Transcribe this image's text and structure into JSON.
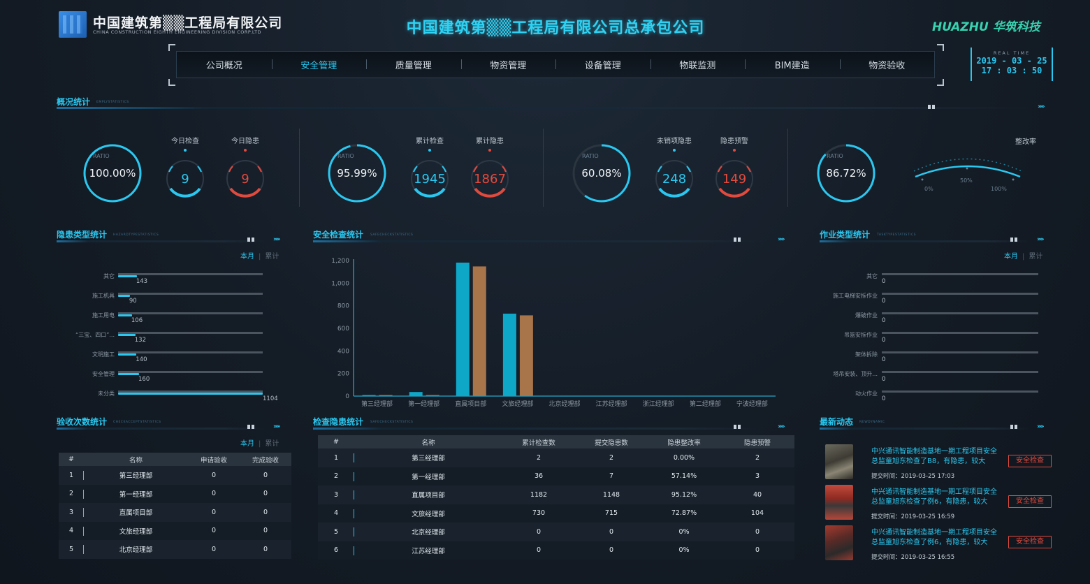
{
  "header": {
    "company_cn": "中国建筑第▒▒工程局有限公司",
    "company_en": "CHINA CONSTRUCTION EIGHTH ENGINEERING DIVISION CORP.LTD",
    "title": "中国建筑第▒▒工程局有限公司总承包公司",
    "brand": "HUAZHU 华筑科技"
  },
  "nav": {
    "items": [
      "公司概况",
      "安全管理",
      "质量管理",
      "物资管理",
      "设备管理",
      "物联监测",
      "BIM建造",
      "物资验收"
    ],
    "active_index": 1
  },
  "clock": {
    "label": "REAL TIME",
    "date": "2019 - 03 - 25",
    "time": "17 : 03 : 50"
  },
  "sections": {
    "overview": {
      "title": "概况统计",
      "sub": "EMPLYSTATISTICS"
    },
    "hazard_type": {
      "title": "隐患类型统计",
      "sub": "HAZARDTYPESTATISTICS"
    },
    "safety_check": {
      "title": "安全检查统计",
      "sub": "SAFECHECKSTATISTICS"
    },
    "work_type": {
      "title": "作业类型统计",
      "sub": "TASKTYPESTATISTICS"
    },
    "acceptance": {
      "title": "验收次数统计",
      "sub": "CHECKACCEPTSTATISTICS"
    },
    "check_hazard": {
      "title": "检查隐患统计",
      "sub": "SAFECHECKSTATISTICS"
    },
    "news": {
      "title": "最新动态",
      "sub": "NEWDYNAMIC"
    }
  },
  "overview": {
    "ratio_label": "RATIO",
    "groups": [
      {
        "ratio": "100.00%",
        "ratio_value": 1.0,
        "a_label": "今日检查",
        "a_value": "9",
        "b_label": "今日隐患",
        "b_value": "9"
      },
      {
        "ratio": "95.99%",
        "ratio_value": 0.9599,
        "a_label": "累计检查",
        "a_value": "1945",
        "b_label": "累计隐患",
        "b_value": "1867"
      },
      {
        "ratio": "60.08%",
        "ratio_value": 0.6008,
        "a_label": "未销项隐患",
        "a_value": "248",
        "b_label": "隐患预警",
        "b_value": "149"
      },
      {
        "ratio": "86.72%",
        "ratio_value": 0.8672
      }
    ],
    "rate_meter": {
      "title": "整改率",
      "tick_0": "0%",
      "tick_50": "50%",
      "tick_100": "100%"
    },
    "colors": {
      "accent": "#2ac8f0",
      "alert": "#e24a3e"
    }
  },
  "toggle": {
    "month": "本月",
    "total": "累计"
  },
  "hazard_type": {
    "max": 1104,
    "items": [
      {
        "label": "其它",
        "value": "143",
        "v": 143
      },
      {
        "label": "施工机具",
        "value": "90",
        "v": 90
      },
      {
        "label": "施工用电",
        "value": "106",
        "v": 106
      },
      {
        "label": "“三宝、四口”...",
        "value": "132",
        "v": 132
      },
      {
        "label": "文明施工",
        "value": "140",
        "v": 140
      },
      {
        "label": "安全管理",
        "value": "160",
        "v": 160
      },
      {
        "label": "未分类",
        "value": "1104",
        "v": 1104
      }
    ]
  },
  "work_type": {
    "items": [
      {
        "label": "其它",
        "value": "0"
      },
      {
        "label": "施工电梯安拆作业",
        "value": "0"
      },
      {
        "label": "爆破作业",
        "value": "0"
      },
      {
        "label": "吊篮安拆作业",
        "value": "0"
      },
      {
        "label": "架体拆除",
        "value": "0"
      },
      {
        "label": "塔吊安装、顶升...",
        "value": "0"
      },
      {
        "label": "动火作业",
        "value": "0"
      }
    ]
  },
  "chart_data": {
    "type": "bar",
    "categories": [
      "第三经理部",
      "第一经理部",
      "直属项目部",
      "文旅经理部",
      "北京经理部",
      "江苏经理部",
      "浙江经理部",
      "第二经理部",
      "宁波经理部"
    ],
    "series": [
      {
        "values": [
          2,
          36,
          1182,
          730,
          0,
          0,
          0,
          0,
          0
        ],
        "color": "#0fa7c8"
      },
      {
        "values": [
          2,
          7,
          1148,
          715,
          0,
          0,
          0,
          0,
          0
        ],
        "color": "#a8744a"
      }
    ],
    "yticks": [
      "0",
      "200",
      "400",
      "600",
      "800",
      "1,000",
      "1,200"
    ],
    "ylim": [
      0,
      1200
    ]
  },
  "acceptance": {
    "headers": [
      "#",
      "名称",
      "申请验收",
      "完成验收"
    ],
    "rows": [
      [
        "1",
        "第三经理部",
        "0",
        "0"
      ],
      [
        "2",
        "第一经理部",
        "0",
        "0"
      ],
      [
        "3",
        "直属项目部",
        "0",
        "0"
      ],
      [
        "4",
        "文旅经理部",
        "0",
        "0"
      ],
      [
        "5",
        "北京经理部",
        "0",
        "0"
      ]
    ]
  },
  "check_hazard": {
    "headers": [
      "#",
      "名称",
      "累计检查数",
      "提交隐患数",
      "隐患整改率",
      "隐患预警"
    ],
    "rows": [
      [
        "1",
        "第三经理部",
        "2",
        "2",
        "0.00%",
        "2"
      ],
      [
        "2",
        "第一经理部",
        "36",
        "7",
        "57.14%",
        "3"
      ],
      [
        "3",
        "直属项目部",
        "1182",
        "1148",
        "95.12%",
        "40"
      ],
      [
        "4",
        "文旅经理部",
        "730",
        "715",
        "72.87%",
        "104"
      ],
      [
        "5",
        "北京经理部",
        "0",
        "0",
        "0%",
        "0"
      ],
      [
        "6",
        "江苏经理部",
        "0",
        "0",
        "0%",
        "0"
      ]
    ]
  },
  "news": {
    "items": [
      {
        "text": "中兴通讯智能制造基地一期工程项目安全总监童旭东检查了B8，有隐患，较大",
        "time": "提交时间：2019-03-25 17:03",
        "button": "安全检查"
      },
      {
        "text": "中兴通讯智能制造基地一期工程项目安全总监童旭东检查了例6，有隐患，较大",
        "time": "提交时间：2019-03-25 16:59",
        "button": "安全检查"
      },
      {
        "text": "中兴通讯智能制造基地一期工程项目安全总监童旭东检查了例6，有隐患，较大",
        "time": "提交时间：2019-03-25 16:55",
        "button": "安全检查"
      }
    ]
  }
}
